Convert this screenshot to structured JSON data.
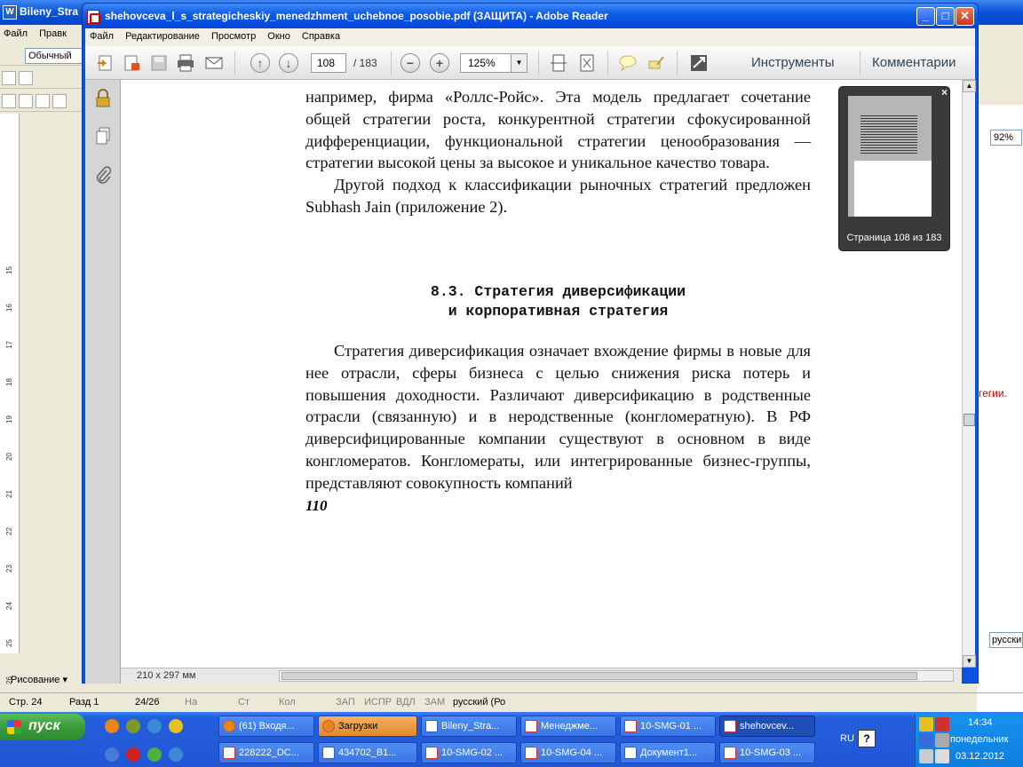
{
  "word": {
    "title": "Bileny_Stra",
    "menu": [
      "Файл",
      "Правк"
    ],
    "style_box": "Обычный",
    "zoom": "92%",
    "red_fragment": "гегии.",
    "lang_box": "русски",
    "draw_label": "Рисование ▾",
    "ruler_numbers": [
      "15",
      "16",
      "17",
      "18",
      "19",
      "20",
      "21",
      "22",
      "23",
      "24",
      "25",
      "26",
      "27",
      "28"
    ],
    "status": {
      "page": "Стр. 24",
      "section": "Разд 1",
      "pages": "24/26",
      "at": "На",
      "line": "Ст",
      "col": "Кол",
      "rec": "ЗАП",
      "trk": "ИСПР",
      "ext": "ВДЛ",
      "ovr": "ЗАМ",
      "lang": "русский (Ро"
    }
  },
  "reader": {
    "title": "shehovceva_l_s_strategicheskiy_menedzhment_uchebnoe_posobie.pdf (ЗАЩИТА) - Adobe Reader",
    "menu": [
      "Файл",
      "Редактирование",
      "Просмотр",
      "Окно",
      "Справка"
    ],
    "page_current": "108",
    "page_total": "/ 183",
    "zoom": "125%",
    "tools_link": "Инструменты",
    "comments_link": "Комментарии",
    "page_size": "210 x 297 мм",
    "preview_caption": "Страница 108 из 183",
    "icons": [
      "create-pdf-icon",
      "save-icon",
      "print-icon",
      "email-icon",
      "prev-page-icon",
      "next-page-icon",
      "zoom-out-icon",
      "zoom-in-icon",
      "fit-page-icon",
      "fit-width-icon",
      "comment-icon",
      "highlight-icon",
      "fullscreen-icon",
      "lock-icon",
      "pages-icon",
      "attachment-icon"
    ]
  },
  "document": {
    "para1": "например, фирма «Роллс-Ройс». Эта модель предлагает сочетание общей стратегии роста, конкурентной стратегии сфокусированной дифференциации, функциональной стратегии ценообразования — стратегии высокой цены за высокое и уникальное качество товара.",
    "para2": "Другой подход к классификации рыночных стратегий предложен Subhash Jain (приложение 2).",
    "heading_line1": "8.3. Стратегия диверсификации",
    "heading_line2": "и корпоративная стратегия",
    "para3": "Стратегия диверсификация означает вхождение фирмы в новые для нее отрасли, сферы бизнеса с целью снижения риска потерь и повышения доходности. Различают диверсификацию в родственные отрасли (связанную) и в неродственные (конгломератную). В РФ диверсифицированные компании существуют в основном в виде конгломератов. Конгломераты, или интегрированные бизнес-группы, представляют совокупность компаний",
    "page_number": "110"
  },
  "taskbar": {
    "start": "пуск",
    "row1": [
      "(61) Входя...",
      "Загрузки",
      "Bileny_Stra...",
      "Менеджме...",
      "10-SMG-01 ...",
      "shehovcev..."
    ],
    "row2": [
      "228222_DC...",
      "434702_B1...",
      "10-SMG-02 ...",
      "10-SMG-04 ...",
      "Документ1...",
      "10-SMG-03 ..."
    ],
    "lang": "RU",
    "time": "14:34",
    "day": "понедельник",
    "date": "03.12.2012"
  }
}
